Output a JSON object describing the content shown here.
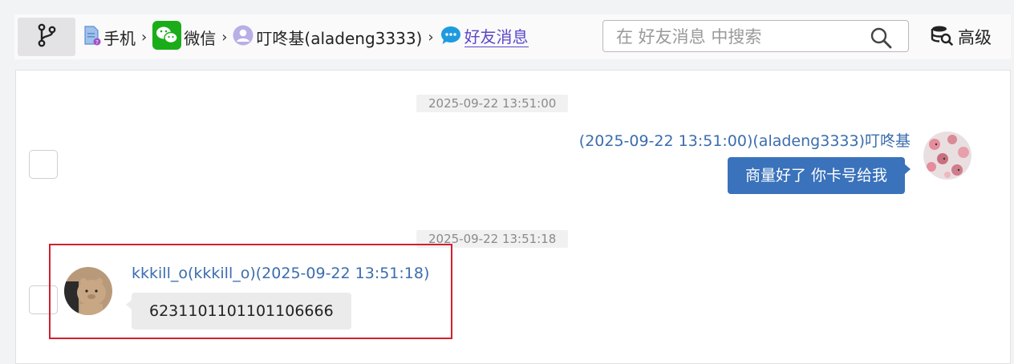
{
  "breadcrumb": {
    "items": [
      {
        "label": "手机",
        "icon": "phone-doc-icon"
      },
      {
        "label": "微信",
        "icon": "wechat-icon"
      },
      {
        "label": "叮咚基(aladeng3333)",
        "icon": "user-avatar-icon"
      },
      {
        "label": "好友消息",
        "icon": "chat-bubble-icon"
      }
    ],
    "separator": "›"
  },
  "search": {
    "placeholder": "在 好友消息 中搜索",
    "value": ""
  },
  "advanced": {
    "label": "高级"
  },
  "messages": [
    {
      "timestamp": "2025-09-22 13:51:00",
      "direction": "outgoing",
      "header": "(2025-09-22 13:51:00)(aladeng3333)叮咚基",
      "text": "商量好了 你卡号给我"
    },
    {
      "timestamp": "2025-09-22 13:51:18",
      "direction": "incoming",
      "header": "kkkill_o(kkkill_o)(2025-09-22 13:51:18)",
      "text": "6231101101101106666"
    }
  ],
  "colors": {
    "accent": "#5b48c9",
    "link_name": "#3b6dae",
    "outgoing_bubble": "#3a72bb",
    "incoming_bubble": "#ebebeb",
    "highlight_border": "#d1202e",
    "wechat_green": "#1aad19"
  }
}
